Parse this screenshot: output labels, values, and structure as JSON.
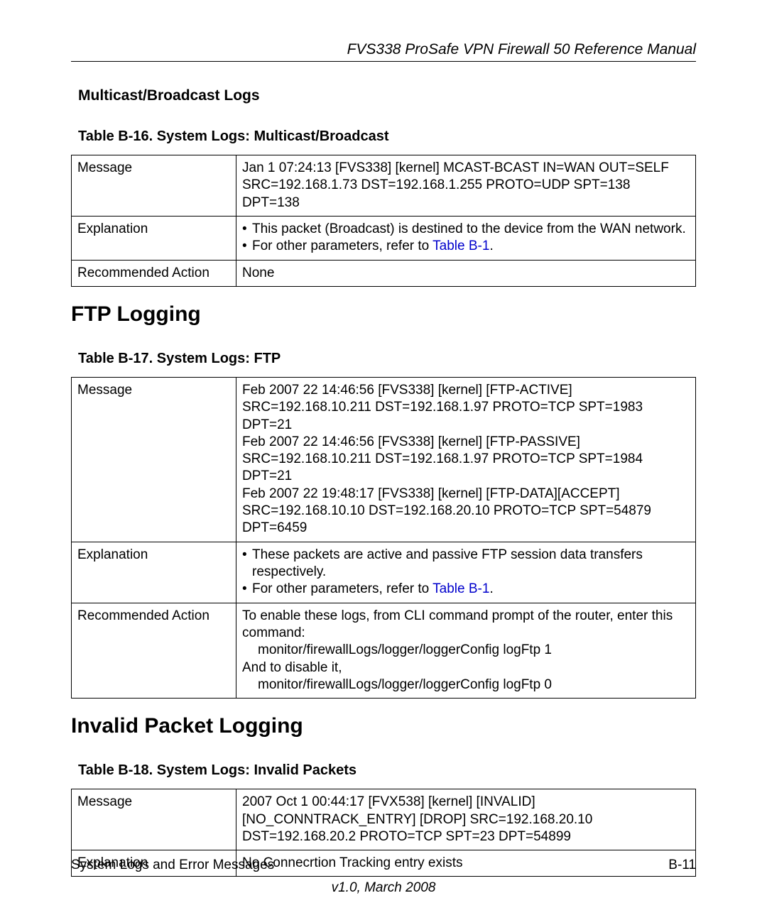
{
  "header": {
    "title": "FVS338 ProSafe VPN Firewall 50 Reference Manual"
  },
  "labels": {
    "message": "Message",
    "explanation": "Explanation",
    "action": "Recommended Action"
  },
  "sec1": {
    "subhead": "Multicast/Broadcast Logs",
    "caption": "Table B-16. System Logs: Multicast/Broadcast",
    "message": "Jan 1 07:24:13 [FVS338] [kernel] MCAST-BCAST IN=WAN OUT=SELF SRC=192.168.1.73 DST=192.168.1.255 PROTO=UDP SPT=138 DPT=138",
    "exp_b1": "This packet (Broadcast) is destined to the device from the WAN network.",
    "exp_b2_pre": "For other parameters, refer to ",
    "exp_b2_link": "Table B-1",
    "exp_b2_post": ".",
    "action": "None"
  },
  "sec2": {
    "heading": "FTP Logging",
    "caption": "Table B-17. System Logs: FTP",
    "msg_l1": "Feb 2007 22 14:46:56 [FVS338] [kernel] [FTP-ACTIVE] SRC=192.168.10.211 DST=192.168.1.97 PROTO=TCP SPT=1983 DPT=21",
    "msg_l2": "Feb 2007 22 14:46:56 [FVS338] [kernel] [FTP-PASSIVE] SRC=192.168.10.211 DST=192.168.1.97 PROTO=TCP SPT=1984 DPT=21",
    "msg_l3": "Feb 2007 22 19:48:17 [FVS338] [kernel] [FTP-DATA][ACCEPT] SRC=192.168.10.10 DST=192.168.20.10 PROTO=TCP SPT=54879 DPT=6459",
    "exp_b1": "These packets are active and passive FTP session data transfers respectively.",
    "exp_b2_pre": "For other parameters, refer to ",
    "exp_b2_link": "Table B-1",
    "exp_b2_post": ".",
    "act_l1": "To enable these logs, from CLI command prompt of the router, enter this command:",
    "act_l2": "monitor/firewallLogs/logger/loggerConfig logFtp 1",
    "act_l3": "And to disable it,",
    "act_l4": "monitor/firewallLogs/logger/loggerConfig logFtp 0"
  },
  "sec3": {
    "heading": "Invalid Packet Logging",
    "caption": "Table B-18. System Logs: Invalid Packets",
    "msg_l1": "2007 Oct 1 00:44:17 [FVX538] [kernel] [INVALID] [NO_CONNTRACK_ENTRY] [DROP] SRC=192.168.20.10 DST=192.168.20.2 PROTO=TCP SPT=23 DPT=54899",
    "explanation": "No Connecrtion Tracking entry exists"
  },
  "footer": {
    "left": "System Logs and Error Messages",
    "right": "B-11",
    "version": "v1.0, March 2008"
  }
}
